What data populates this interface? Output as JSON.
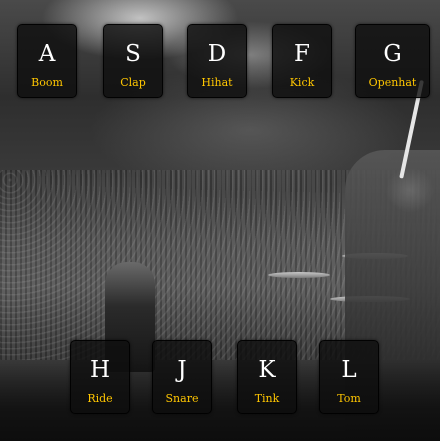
{
  "background": {
    "description_icon": "concert-photo"
  },
  "colors": {
    "key_text": "#ffffff",
    "sound_text": "#ffc600",
    "pad_background": "rgba(14,14,14,0.80)"
  },
  "pads": [
    {
      "key": "A",
      "sound": "Boom"
    },
    {
      "key": "S",
      "sound": "Clap"
    },
    {
      "key": "D",
      "sound": "Hihat"
    },
    {
      "key": "F",
      "sound": "Kick"
    },
    {
      "key": "G",
      "sound": "Openhat"
    },
    {
      "key": "H",
      "sound": "Ride"
    },
    {
      "key": "J",
      "sound": "Snare"
    },
    {
      "key": "K",
      "sound": "Tink"
    },
    {
      "key": "L",
      "sound": "Tom"
    }
  ]
}
